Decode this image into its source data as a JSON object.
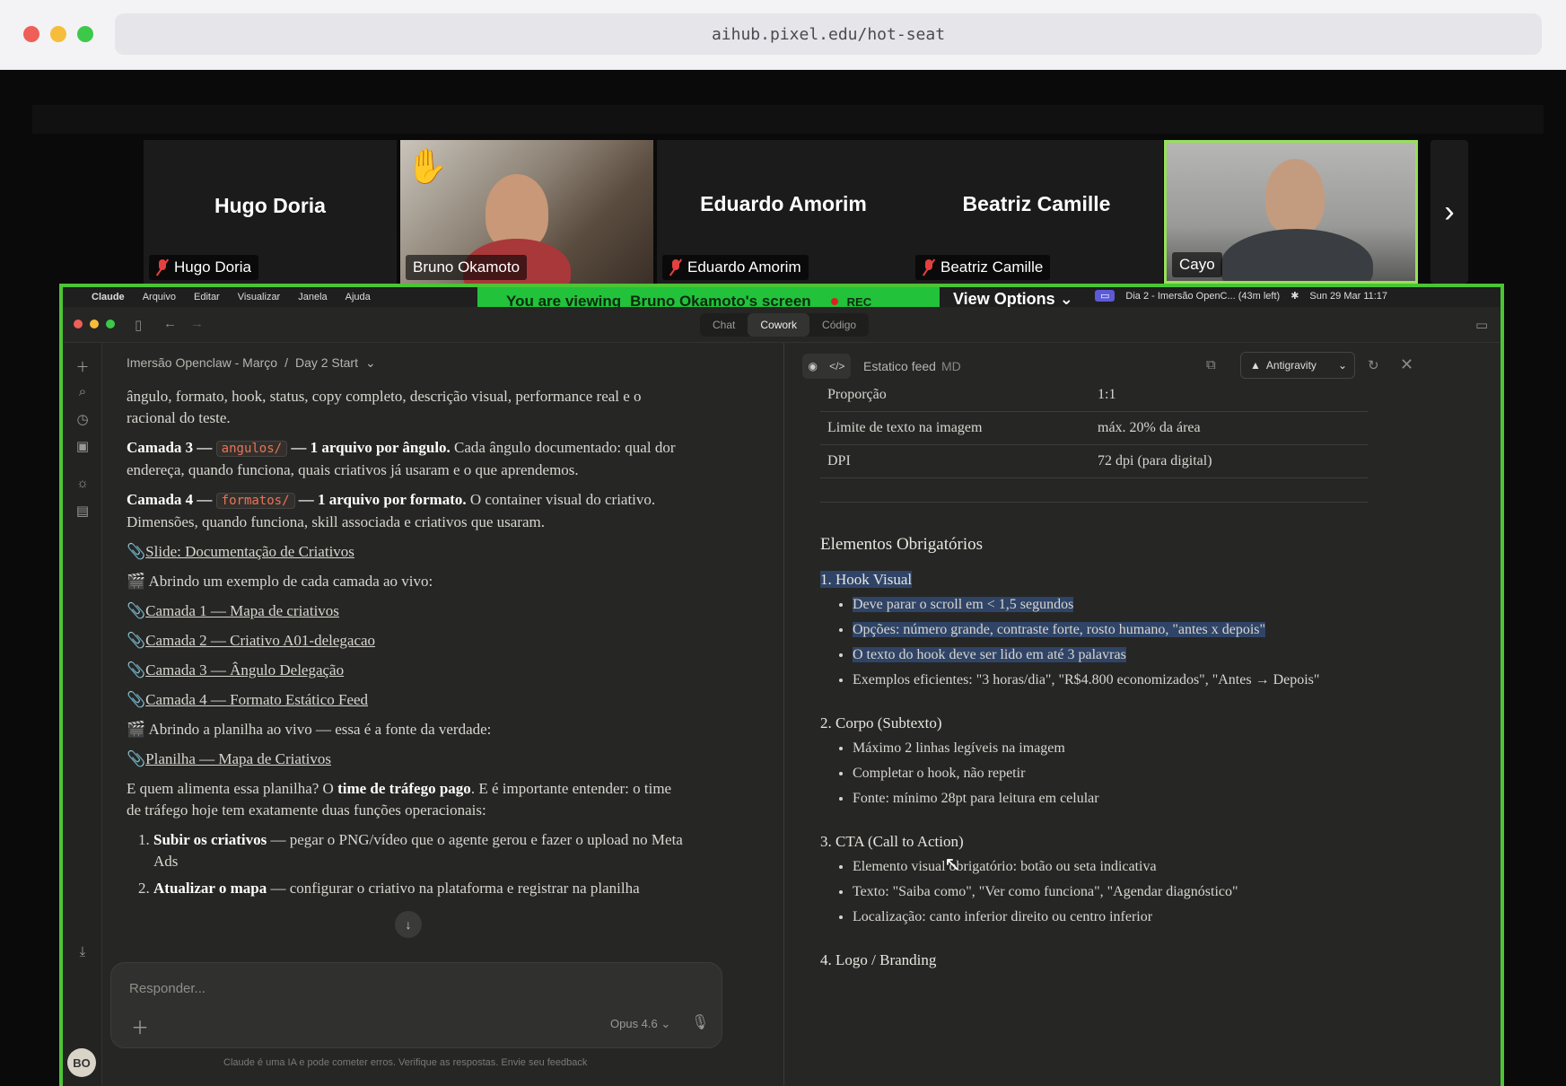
{
  "browser": {
    "url": "aihub.pixel.edu/hot-seat"
  },
  "participants": [
    {
      "name": "Hugo Doria",
      "label": "Hugo Doria",
      "muted": true
    },
    {
      "name": "",
      "label": "Bruno Okamoto",
      "muted": false
    },
    {
      "name": "Eduardo Amorim",
      "label": "Eduardo Amorim",
      "muted": true
    },
    {
      "name": "Beatriz Camille",
      "label": "Beatriz Camille",
      "muted": true
    },
    {
      "name": "",
      "label": "Cayo",
      "muted": false
    }
  ],
  "share": {
    "viewing_prefix": "You are viewing",
    "viewing_name": "Bruno Okamoto's screen",
    "rec": "REC",
    "view_options": "View Options"
  },
  "macbar": {
    "app": "Claude",
    "menus": [
      "Arquivo",
      "Editar",
      "Visualizar",
      "Janela",
      "Ajuda"
    ],
    "status": "Dia 2 - Imersão OpenC... (43m left)",
    "clock": "Sun 29 Mar  11:17"
  },
  "app": {
    "modes": [
      "Chat",
      "Cowork",
      "Código"
    ],
    "active_mode": "Cowork"
  },
  "chat": {
    "breadcrumb_project": "Imersão Openclaw - Março",
    "breadcrumb_sep": "/",
    "breadcrumb_chat": "Day 2 Start",
    "para0": "ângulo, formato, hook, status, copy completo, descrição visual, performance real e o racional do teste.",
    "c3_label": "Camada 3 —",
    "c3_code": "angulos/",
    "c3_bold": "— 1 arquivo por ângulo.",
    "c3_text": "Cada ângulo documentado: qual dor endereça, quando funciona, quais criativos já usaram e o que aprendemos.",
    "c4_label": "Camada 4 —",
    "c4_code": "formatos/",
    "c4_bold": "— 1 arquivo por formato.",
    "c4_text": "O container visual do criativo. Dimensões, quando funciona, skill associada e criativos que usaram.",
    "link1": "Slide: Documentação de Criativos",
    "line_abrindo1": "Abrindo um exemplo de cada camada ao vivo:",
    "link2": "Camada 1 — Mapa de criativos",
    "link3": "Camada 2 — Criativo A01-delegacao",
    "link4": "Camada 3 — Ângulo Delegação",
    "link5": "Camada 4 — Formato Estático Feed",
    "line_abrindo2": "Abrindo a planilha ao vivo — essa é a fonte da verdade:",
    "link6": "Planilha — Mapa de Criativos",
    "p_quem1": "E quem alimenta essa planilha? O",
    "p_quem_bold": "time de tráfego pago",
    "p_quem2": ". E é importante entender: o time de tráfego hoje tem exatamente duas funções operacionais:",
    "li1_bold": "Subir os criativos",
    "li1_text": "— pegar o PNG/vídeo que o agente gerou e fazer o upload no Meta Ads",
    "li2_bold": "Atualizar o mapa",
    "li2_text": "— configurar o criativo na plataforma e registrar na planilha",
    "reply_placeholder": "Responder...",
    "model": "Opus 4.6",
    "disclaimer": "Claude é uma IA e pode cometer erros. Verifique as respostas. Envie seu feedback"
  },
  "doc": {
    "title": "Estatico feed",
    "ext": "MD",
    "open_with": "Antigravity",
    "table": [
      {
        "k": "Proporção",
        "v": "1:1"
      },
      {
        "k": "Limite de texto na imagem",
        "v": "máx. 20% da área"
      },
      {
        "k": "DPI",
        "v": "72 dpi (para digital)"
      }
    ],
    "h_elementos": "Elementos Obrigatórios",
    "s1_title": "1. Hook Visual",
    "s1_items": [
      "Deve parar o scroll em < 1,5 segundos",
      "Opções: número grande, contraste forte, rosto humano, \"antes x depois\"",
      "O texto do hook deve ser lido em até 3 palavras",
      "Exemplos eficientes: \"3 horas/dia\", \"R$4.800 economizados\", \"Antes → Depois\""
    ],
    "s2_title": "2. Corpo (Subtexto)",
    "s2_items": [
      "Máximo 2 linhas legíveis na imagem",
      "Completar o hook, não repetir",
      "Fonte: mínimo 28pt para leitura em celular"
    ],
    "s3_title": "3. CTA (Call to Action)",
    "s3_items": [
      "Elemento visual obrigatório: botão ou seta indicativa",
      "Texto: \"Saiba como\", \"Ver como funciona\", \"Agendar diagnóstico\"",
      "Localização: canto inferior direito ou centro inferior"
    ],
    "s4_title": "4. Logo / Branding"
  },
  "user": {
    "initials": "BO"
  },
  "colors": {
    "share_border": "#4bc534",
    "highlight": "#2f4466",
    "code": "#e7745a"
  }
}
